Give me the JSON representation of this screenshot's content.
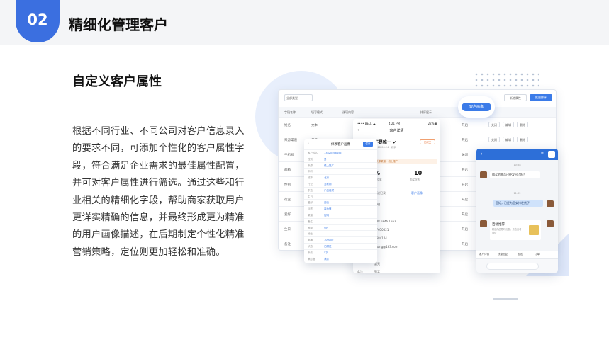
{
  "header": {
    "number": "02",
    "title": "精细化管理客户"
  },
  "section": {
    "title": "自定义客户属性",
    "paragraph": "根据不同行业、不同公司对客户信息录入的要求不同，可添加个性化的客户属性字段，符合满足企业需求的最佳属性配置，并可对客户属性进行筛选。通过这些和行业相关的精细化字段，帮助商家获取用户更详实精确的信息，并最终形成更为精准的用户画像描述，在后期制定个性化精准营销策略，定位则更加轻松和准确。"
  },
  "colors": {
    "accent": "#3b6fe0",
    "header_bg": "#f4f5f7"
  },
  "screenshot": {
    "persona_button": "客户画像",
    "table": {
      "select_label": "全部类型",
      "btn_add": "新增属性",
      "btn_batch": "批量排序",
      "headers": [
        "字段名称",
        "填写格式",
        "选项内容",
        "排序展示"
      ],
      "rows": [
        {
          "name": "姓名",
          "format": "文本",
          "status": "开启"
        },
        {
          "name": "来源渠道",
          "format": "单选",
          "status": "开启"
        },
        {
          "name": "手机号",
          "format": "",
          "status": "关闭"
        },
        {
          "name": "邮箱",
          "format": "",
          "status": "开启"
        },
        {
          "name": "性别",
          "format": "",
          "status": "开启"
        },
        {
          "name": "行业",
          "format": "",
          "status": "开启"
        },
        {
          "name": "爱好",
          "format": "",
          "status": "开启"
        },
        {
          "name": "生日",
          "format": "",
          "status": "开启"
        },
        {
          "name": "备注",
          "format": "",
          "status": "开启"
        }
      ],
      "ops": [
        "关闭",
        "编辑",
        "删除"
      ]
    },
    "phone_detail": {
      "status_left": "•••• BELL ☁",
      "status_time": "4:21 PM",
      "status_right": "22% ▮",
      "nav_title": "客户详情",
      "name": "不是唯一 ✔",
      "tag": "已成交",
      "sub": "2018-06-24 · 北京",
      "banner": "来源渠道：线上推广",
      "stat1": "%",
      "stat2": "10",
      "stat1_label": "成交率",
      "stat2_label": "购买次数",
      "tab1": "跟进记录",
      "tab2": "客户画像",
      "labels": [
        "姓名",
        "性别",
        "电话",
        "",
        "",
        "邮箱",
        "",
        "",
        "备注"
      ],
      "values": [
        "张明",
        "男",
        "138 6846 1562",
        "27650021",
        "4684104",
        "zhang@163.com",
        "",
        "暂无",
        "暂无"
      ]
    },
    "phone_form": {
      "nav_title": "修改客户画像",
      "done": "保存",
      "rows": [
        {
          "k": "客户姓名",
          "v": "13820468456"
        },
        {
          "k": "性别",
          "v": "男"
        },
        {
          "k": "来源",
          "v": "线上推广"
        },
        {
          "k": "年龄",
          "v": ""
        },
        {
          "k": "城市",
          "v": "北京"
        },
        {
          "k": "行业",
          "v": "互联网"
        },
        {
          "k": "职位",
          "v": "产品经理"
        },
        {
          "k": "生日",
          "v": ""
        },
        {
          "k": "爱好",
          "v": "阅读"
        },
        {
          "k": "标签",
          "v": "高价值"
        },
        {
          "k": "渠道",
          "v": "官网"
        },
        {
          "k": "备注",
          "v": ""
        },
        {
          "k": "等级",
          "v": "VIP"
        },
        {
          "k": "地址",
          "v": ""
        },
        {
          "k": "邮编",
          "v": "100000"
        },
        {
          "k": "状态",
          "v": "已跟进"
        },
        {
          "k": "来访",
          "v": "5次"
        },
        {
          "k": "满意度",
          "v": "满意"
        }
      ]
    },
    "phone_chat": {
      "time1": "10:58",
      "time2": "11:02",
      "msg_in": "购买的物品已经发出了吗？",
      "msg_out": "您好，已经为您安排发货了",
      "card_title": "活动推荐",
      "card_desc": "精选商品限时优惠，点击查看详情",
      "tools": [
        "客户详情",
        "快捷回复",
        "发送",
        "订单"
      ]
    }
  }
}
